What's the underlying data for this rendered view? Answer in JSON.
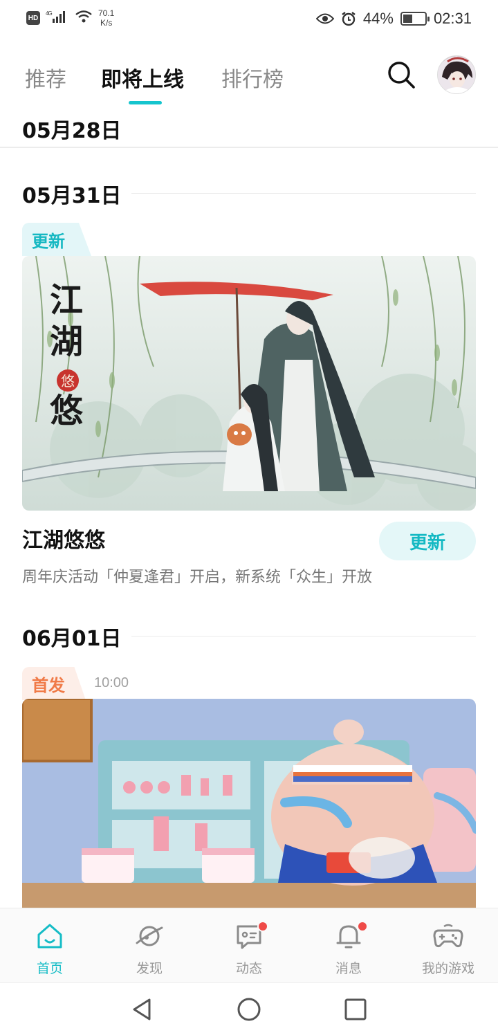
{
  "status_bar": {
    "hd": "HD",
    "network": "4G",
    "speed_value": "70.1",
    "speed_unit": "K/s",
    "battery": "44%",
    "battery_level": 0.44,
    "time": "02:31"
  },
  "top_nav": {
    "tabs": [
      {
        "label": "推荐",
        "active": false
      },
      {
        "label": "即将上线",
        "active": true
      },
      {
        "label": "排行榜",
        "active": false
      }
    ],
    "search_icon": "search-icon",
    "avatar": "user-avatar"
  },
  "sticky_date": "05月28日",
  "sections": [
    {
      "date": "05月31日",
      "tag": "更新",
      "game": {
        "title": "江湖悠悠",
        "description": "周年庆活动「仲夏逢君」开启，新系统「众生」开放",
        "action": "更新",
        "banner_calligraphy": "江湖悠悠"
      }
    },
    {
      "date": "06月01日",
      "tag": "首发",
      "time": "10:00"
    }
  ],
  "bottom_nav": {
    "items": [
      {
        "label": "首页",
        "icon": "home-icon",
        "active": true
      },
      {
        "label": "发现",
        "icon": "planet-icon",
        "active": false
      },
      {
        "label": "动态",
        "icon": "chat-icon",
        "badge": true
      },
      {
        "label": "消息",
        "icon": "bell-icon",
        "badge": true
      },
      {
        "label": "我的游戏",
        "icon": "gamepad-icon",
        "active": false
      }
    ]
  },
  "colors": {
    "accent": "#15c5ce",
    "tag_update_bg": "#e3f6f8",
    "tag_first_bg": "#fdeee8",
    "tag_first_text": "#f07a47",
    "badge_red": "#ef4a47"
  }
}
